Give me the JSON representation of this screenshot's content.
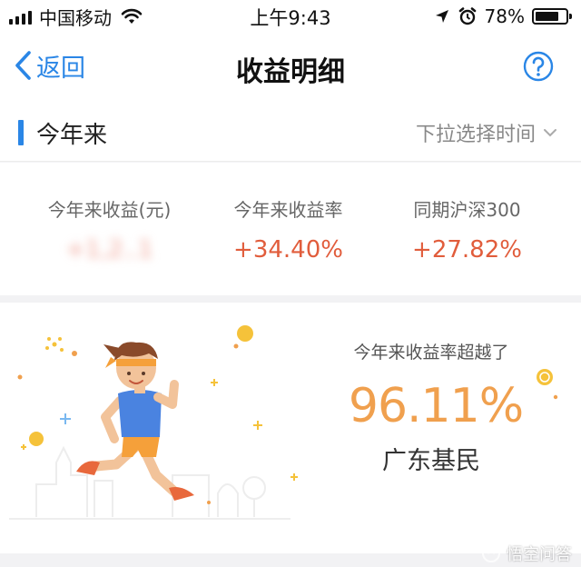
{
  "status_bar": {
    "carrier": "中国移动",
    "time": "上午9:43",
    "battery": "78%",
    "battery_level": 0.78
  },
  "nav": {
    "back_label": "返回",
    "title": "收益明细",
    "help_icon": "question-circle-icon"
  },
  "section": {
    "title": "今年来",
    "time_select_label": "下拉选择时间"
  },
  "stats": [
    {
      "label": "今年来收益(元)",
      "value": "+1,2..1",
      "obscured": true
    },
    {
      "label": "今年来收益率",
      "value": "+34.40%"
    },
    {
      "label": "同期沪深300",
      "value": "+27.82%"
    }
  ],
  "beat": {
    "label": "今年来收益率超越了",
    "value": "96.11%",
    "region": "广东基民"
  },
  "watermark": {
    "text": "悟空问答"
  },
  "colors": {
    "accent": "#2a86e6",
    "gain": "#e15d3c",
    "beat": "#f0a04e"
  }
}
